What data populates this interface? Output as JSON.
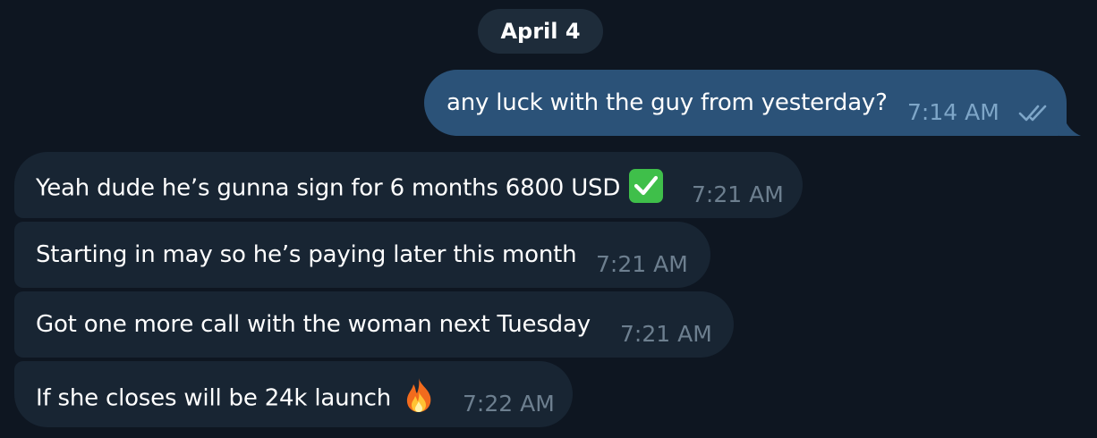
{
  "date_separator": "April 4",
  "messages": [
    {
      "direction": "outgoing",
      "text": "any luck with the guy from yesterday?",
      "time": "7:14 AM",
      "status": "read",
      "status_icon": "double-check-icon"
    },
    {
      "direction": "incoming",
      "text": "Yeah dude he’s gunna sign for 6 months 6800 USD",
      "emoji": "white-check-mark-emoji",
      "time": "7:21 AM"
    },
    {
      "direction": "incoming",
      "text": "Starting in may so he’s paying later this month",
      "time": "7:21 AM"
    },
    {
      "direction": "incoming",
      "text": "Got one more call with the woman next Tuesday",
      "time": "7:21 AM"
    },
    {
      "direction": "incoming",
      "text": "If she closes will be 24k launch",
      "emoji": "fire-emoji",
      "time": "7:22 AM"
    }
  ],
  "colors": {
    "background": "#0e1621",
    "incoming_bubble": "#182533",
    "outgoing_bubble": "#2b5278",
    "date_pill": "#1e2c3a",
    "time_text": "#6d7f8f",
    "outgoing_time_text": "#7ea6c8"
  }
}
